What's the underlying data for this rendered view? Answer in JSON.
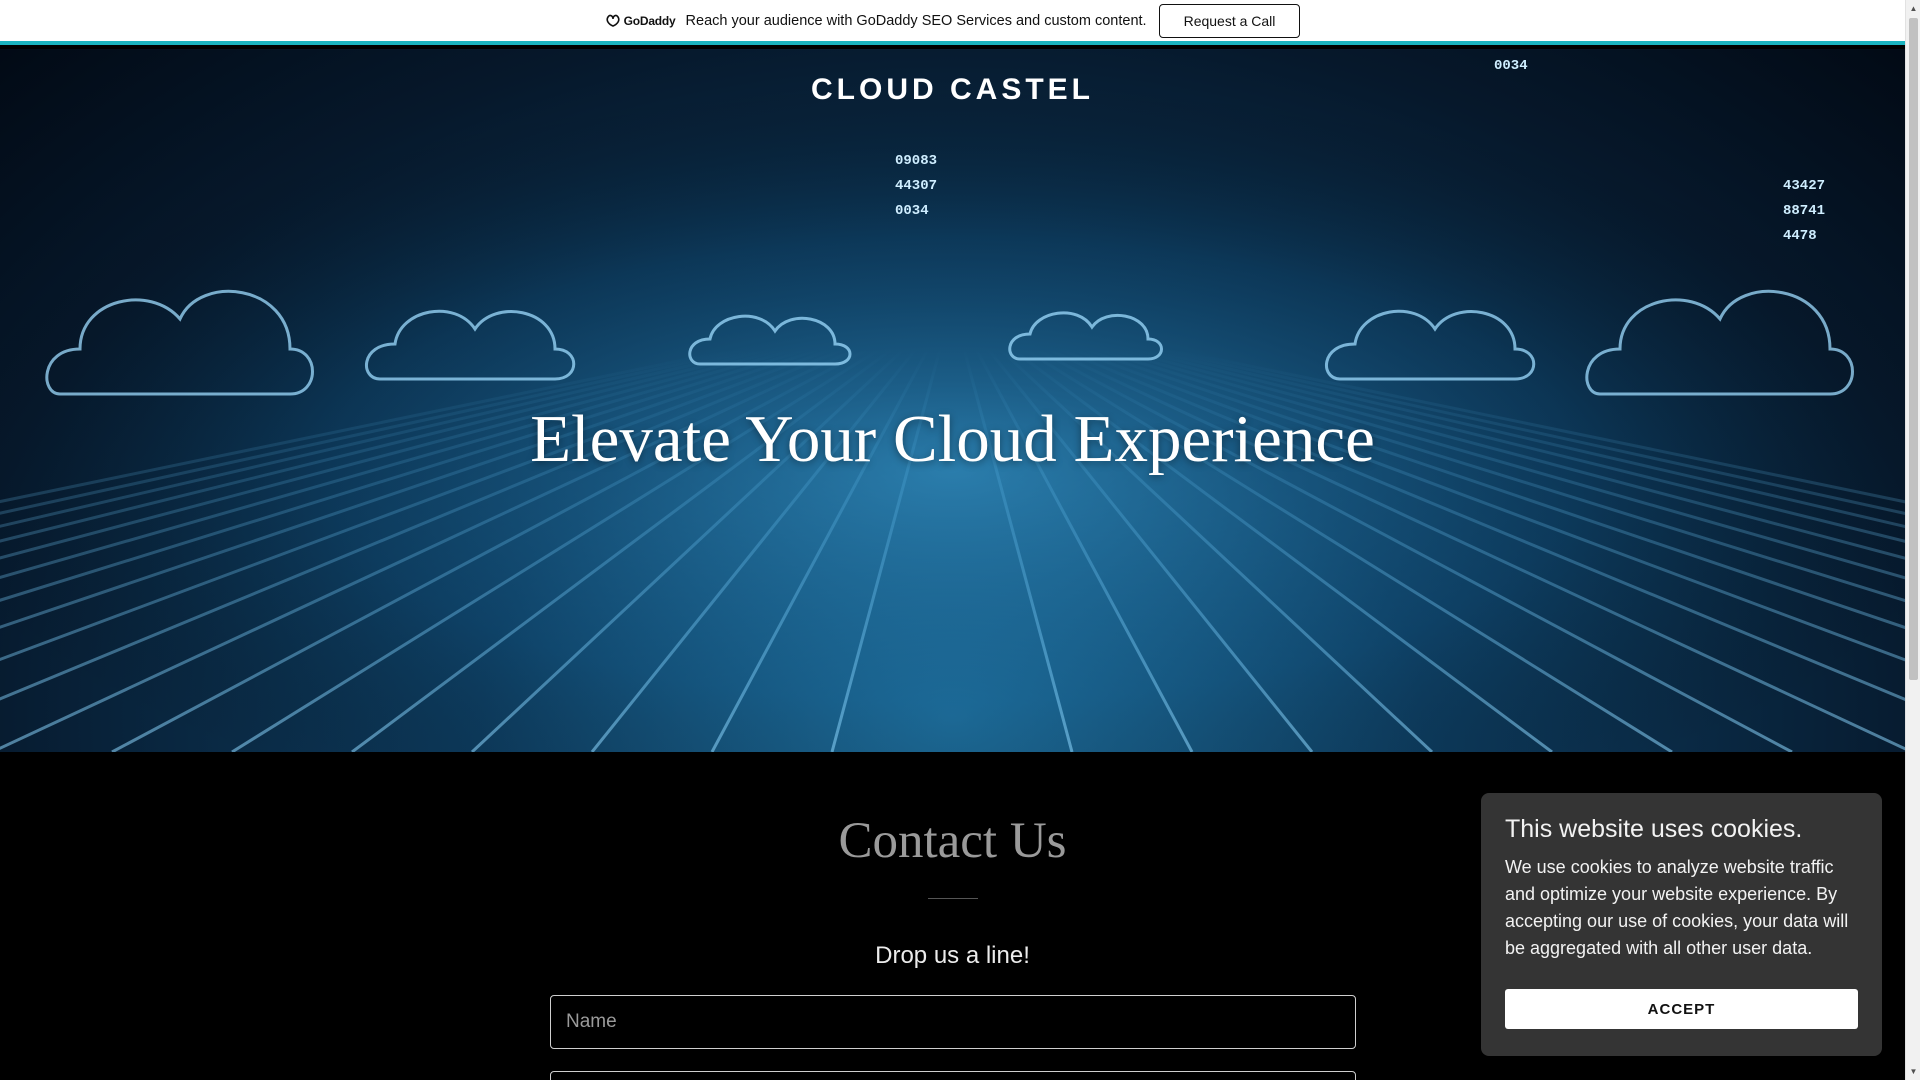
{
  "promo": {
    "logo_text": "GoDaddy",
    "message": "Reach your audience with GoDaddy SEO Services and custom content.",
    "button_label": "Request a Call"
  },
  "hero": {
    "brand": "CLOUD CASTEL",
    "heading": "Elevate Your Cloud Experience",
    "numbers": [
      "09083",
      "44307",
      "0034",
      "43427",
      "88741",
      "4478",
      "0034"
    ]
  },
  "contact": {
    "title": "Contact Us",
    "subtitle": "Drop us a line!",
    "name_placeholder": "Name"
  },
  "cookie": {
    "title": "This website uses cookies.",
    "text": "We use cookies to analyze website traffic and optimize your website experience. By accepting our use of cookies, your data will be aggregated with all other user data.",
    "accept_label": "ACCEPT"
  },
  "colors": {
    "accent_bar": "#1bb3bf",
    "hero_glow": "#1f6f9c",
    "cookie_bg": "#343434"
  }
}
